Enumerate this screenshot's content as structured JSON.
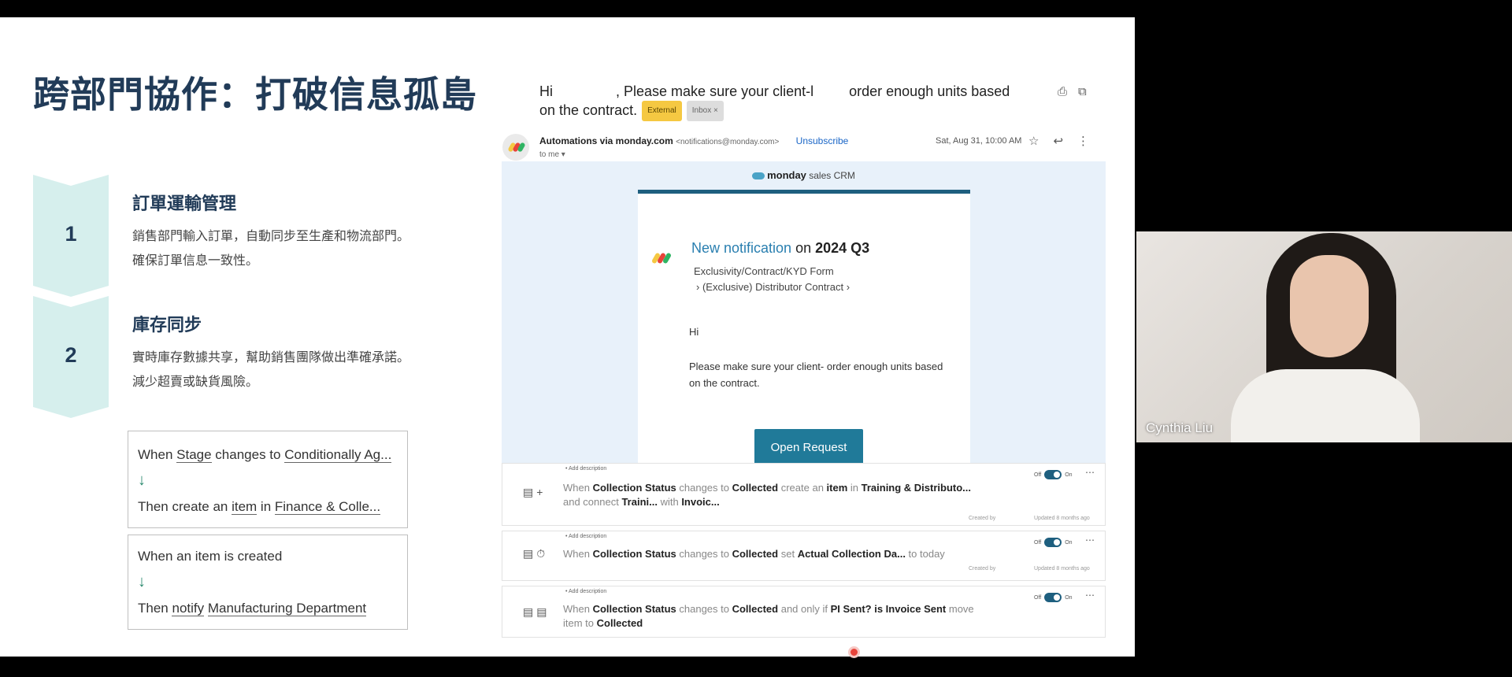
{
  "slide": {
    "title": "跨部門協作：打破信息孤島",
    "steps": [
      {
        "number": "1",
        "title": "訂單運輸管理",
        "lines": [
          "銷售部門輸入訂單，自動同步至生產和物流部門。",
          "確保訂單信息一致性。"
        ]
      },
      {
        "number": "2",
        "title": "庫存同步",
        "lines": [
          "實時庫存數據共享，幫助銷售團隊做出準確承諾。",
          "減少超賣或缺貨風險。"
        ]
      }
    ],
    "rules": [
      {
        "when_prefix": "When ",
        "when_field": "Stage",
        "when_mid": " changes to ",
        "when_value": "Conditionally Ag...",
        "arrow": "↓",
        "then_prefix": "Then create an ",
        "then_item": "item",
        "then_mid": " in ",
        "then_value": "Finance & Colle..."
      },
      {
        "when_text": "When an item is created",
        "arrow": "↓",
        "then_prefix": "Then ",
        "then_action": "notify",
        "then_target": "Manufacturing Department"
      }
    ]
  },
  "email": {
    "subject_line1": "Hi                , Please make sure your client-l         order enough units based",
    "subject_line2": "on the contract.",
    "chip_external": "External",
    "chip_inbox": "Inbox ×",
    "sender_name": "Automations via monday.com",
    "sender_address": "<notifications@monday.com>",
    "unsubscribe": "Unsubscribe",
    "to_me": "to me ▾",
    "date": "Sat, Aug 31, 10:00 AM",
    "crm_brand": "monday",
    "crm_suffix": " sales CRM",
    "notif_title_prefix": "New notification",
    "notif_title_on": " on ",
    "notif_title_board": "2024 Q3",
    "breadcrumb_1": "Exclusivity/Contract/KYD Form",
    "breadcrumb_2": "›  (Exclusive) Distributor Contract  ›",
    "greeting": "Hi",
    "message": "Please make sure your client-          order enough units based on the contract.",
    "open_button": "Open Request"
  },
  "automations": [
    {
      "add_description": "• Add description",
      "w1": "When ",
      "b1": "Collection Status",
      "w2": " changes to ",
      "b2": "Collected",
      "w3": " create an ",
      "b3": "item",
      "w4": " in ",
      "b4": "Training & Distributo...",
      "line2_w": "and connect ",
      "line2_b1": "Traini...",
      "line2_w2": " with ",
      "line2_b2": "Invoic...",
      "toggle_off": "Off",
      "toggle_on": "On",
      "created_by": "Created by",
      "updated": "Updated 8 months ago"
    },
    {
      "add_description": "• Add description",
      "w1": "When ",
      "b1": "Collection Status",
      "w2": " changes to ",
      "b2": "Collected",
      "w3": " set ",
      "b3": "Actual Collection Da...",
      "w4": " to today",
      "toggle_off": "Off",
      "toggle_on": "On",
      "created_by": "Created by",
      "updated": "Updated 8 months ago"
    },
    {
      "add_description": "• Add description",
      "w1": "When ",
      "b1": "Collection Status",
      "w2": " changes to ",
      "b2": "Collected",
      "w3": " and only if ",
      "b3": "PI Sent? is Invoice Sent",
      "w4": " move",
      "line2_w": "item to ",
      "line2_b1": "Collected",
      "toggle_off": "Off",
      "toggle_on": "On"
    }
  ],
  "webcam": {
    "participant_name": "Cynthia Liu"
  },
  "colors": {
    "title_navy": "#213b58",
    "chevron_mint": "#d6efed",
    "monday_teal": "#1e5f7f",
    "button_teal": "#207a99",
    "link_blue": "#1a66c7",
    "external_yellow": "#f5c842",
    "record_red": "#e8433a"
  }
}
